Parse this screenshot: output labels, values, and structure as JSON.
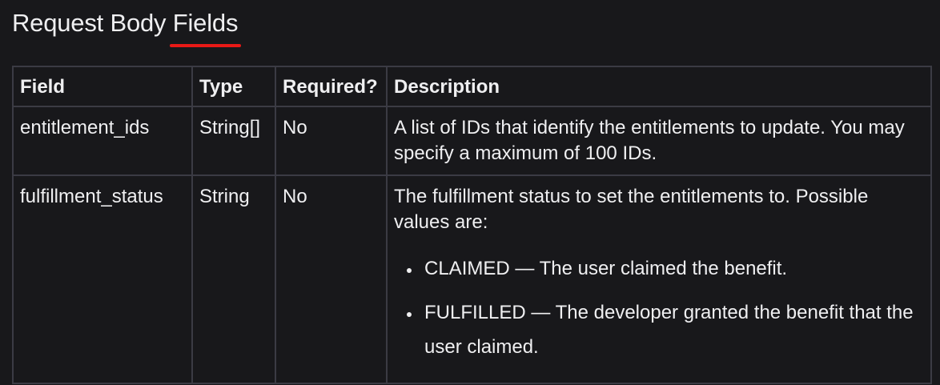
{
  "heading": {
    "text_before": "Request Body ",
    "text_marked": "Fields",
    "underline_color": "#e91916"
  },
  "table": {
    "headers": {
      "field": "Field",
      "type": "Type",
      "required": "Required?",
      "description": "Description"
    },
    "rows": [
      {
        "field": "entitlement_ids",
        "type": "String[]",
        "required": "No",
        "description": "A list of IDs that identify the entitlements to update. You may specify a maximum of 100 IDs."
      },
      {
        "field": "fulfillment_status",
        "type": "String",
        "required": "No",
        "description": "The fulfillment status to set the entitlements to. Possible values are:",
        "values": [
          "CLAIMED — The user claimed the benefit.",
          "FULFILLED — The developer granted the benefit that the user claimed."
        ]
      }
    ]
  },
  "colors": {
    "background": "#18181b",
    "text": "#efeff1",
    "border": "#3b3b44"
  }
}
